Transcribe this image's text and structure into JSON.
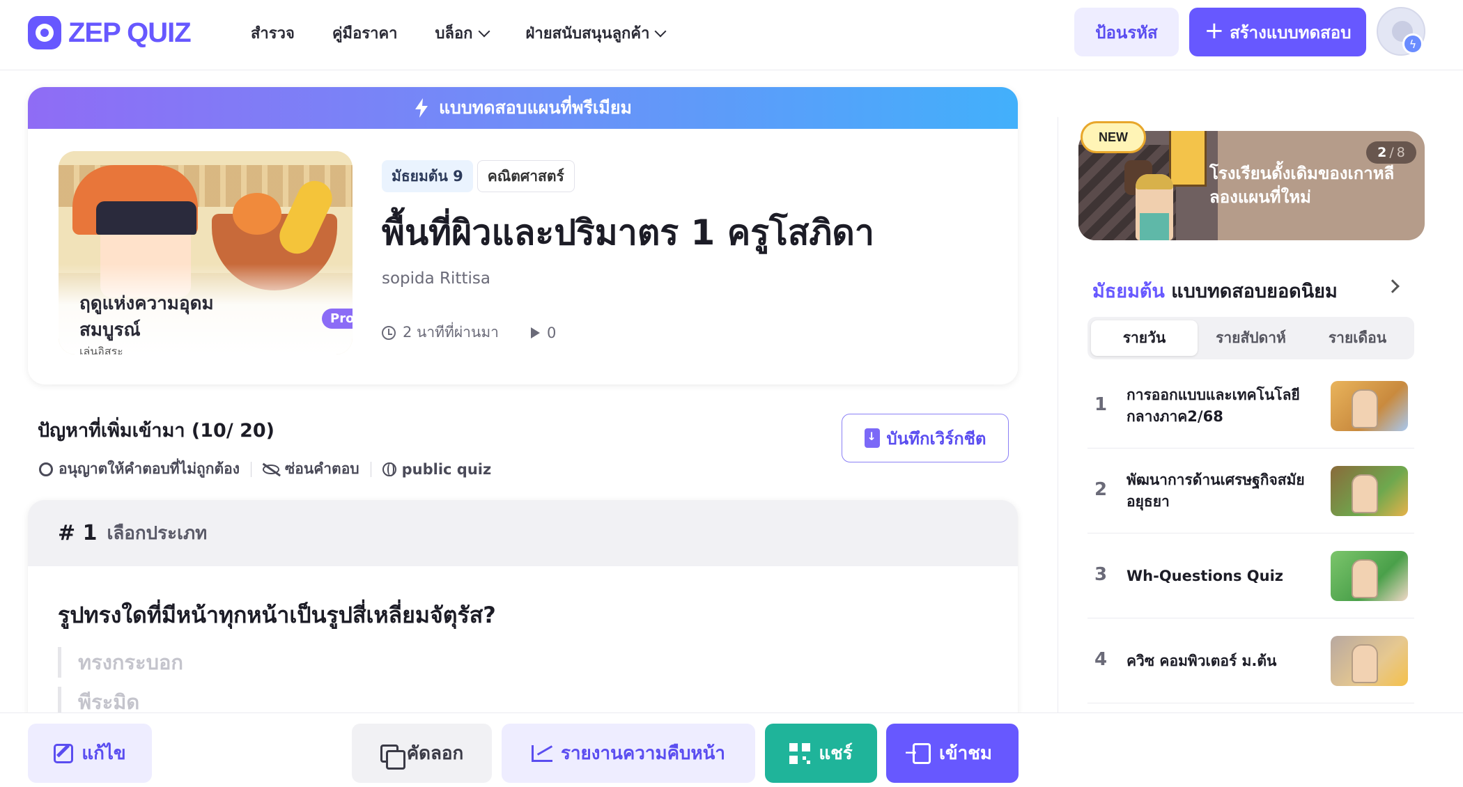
{
  "header": {
    "logo_text": "ZEP QUIZ",
    "nav": [
      {
        "label": "สำรวจ"
      },
      {
        "label": "คู่มือราคา"
      },
      {
        "label": "บล็อก"
      },
      {
        "label": "ฝ่ายสนับสนุนลูกค้า"
      }
    ],
    "enter_code_label": "ป้อนรหัส",
    "create_label": "สร้างแบบทดสอบ"
  },
  "quiz": {
    "banner": "แบบทดสอบแผนที่พรีเมียม",
    "map_name": "ฤดูแห่งความอุดมสมบูรณ์",
    "map_mode": "เล่นอิสระ",
    "pro_badge": "Pro",
    "grade_tag": "มัธยมต้น 9",
    "subject_tag": "คณิตศาสตร์",
    "title": "พื้นที่ผิวและปริมาตร 1 ครูโสภิดา",
    "author": "sopida Rittisa",
    "time_ago": "2 นาทีที่ผ่านมา",
    "plays": "0"
  },
  "problems": {
    "heading": "ปัญหาที่เพิ่มเข้ามา (10/ 20)",
    "options": [
      "อนุญาตให้คำตอบที่ไม่ถูกต้อง",
      "ซ่อนคำตอบ",
      "public quiz"
    ],
    "worksheet_label": "บันทึกเวิร์กชีต"
  },
  "question": {
    "number": "# 1",
    "type": "เลือกประเภท",
    "text": "รูปทรงใดที่มีหน้าทุกหน้าเป็นรูปสี่เหลี่ยมจัตุรัส?",
    "answers": [
      "ทรงกระบอก",
      "พีระมิด"
    ]
  },
  "bottom_bar": {
    "edit": "แก้ไข",
    "copy": "คัดลอก",
    "report": "รายงานความคืบหน้า",
    "share": "แชร์",
    "enter": "เข้าชม"
  },
  "sidebar": {
    "promo": {
      "badge": "NEW",
      "current": "2",
      "total": "8",
      "text_line1": "โรงเรียนดั้งเดิมของเกาหลี",
      "text_line2": "ลองแผนที่ใหม่"
    },
    "popular": {
      "accent": "มัธยมต้น",
      "title": "แบบทดสอบยอดนิยม",
      "tabs": [
        "รายวัน",
        "รายสัปดาห์",
        "รายเดือน"
      ],
      "active_tab": "รายวัน",
      "items": [
        {
          "rank": "1",
          "title": "การออกแบบและเทคโนโลยี กลางภาค2/68"
        },
        {
          "rank": "2",
          "title": "พัฒนาการด้านเศรษฐกิจสมัยอยุธยา"
        },
        {
          "rank": "3",
          "title": "Wh-Questions Quiz"
        },
        {
          "rank": "4",
          "title": "ควิซ คอมพิวเตอร์ ม.ต้น"
        }
      ]
    }
  },
  "colors": {
    "brand": "#6758ff",
    "share": "#1fb49a",
    "banner_start": "#8f6cf5",
    "banner_end": "#42b0fb"
  }
}
